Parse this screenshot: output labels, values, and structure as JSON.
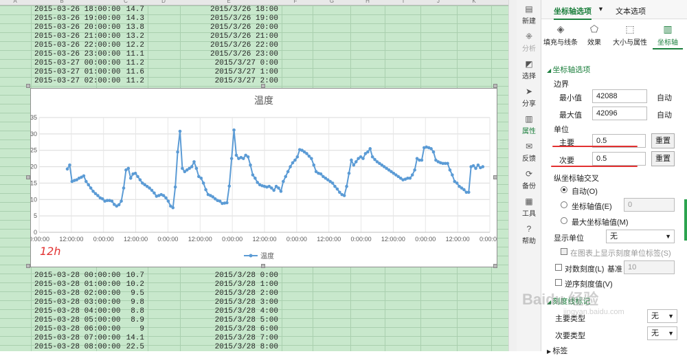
{
  "sheet": {
    "col_headers": [
      "A",
      "B",
      "C",
      "D",
      "E",
      "F",
      "G",
      "H",
      "I",
      "J",
      "K"
    ],
    "rows_top": [
      {
        "b": "2015-03-26 18:00:00",
        "c": "14.7",
        "e": "2015/3/26 18:00"
      },
      {
        "b": "2015-03-26 19:00:00",
        "c": "14.3",
        "e": "2015/3/26 19:00"
      },
      {
        "b": "2015-03-26 20:00:00",
        "c": "13.8",
        "e": "2015/3/26 20:00"
      },
      {
        "b": "2015-03-26 21:00:00",
        "c": "13.2",
        "e": "2015/3/26 21:00"
      },
      {
        "b": "2015-03-26 22:00:00",
        "c": "12.2",
        "e": "2015/3/26 22:00"
      },
      {
        "b": "2015-03-26 23:00:00",
        "c": "11.1",
        "e": "2015/3/26 23:00"
      },
      {
        "b": "2015-03-27 00:00:00",
        "c": "11.2",
        "e": "2015/3/27 0:00"
      },
      {
        "b": "2015-03-27 01:00:00",
        "c": "11.6",
        "e": "2015/3/27 1:00"
      },
      {
        "b": "2015-03-27 02:00:00",
        "c": "11.2",
        "e": "2015/3/27 2:00"
      }
    ],
    "rows_bottom": [
      {
        "b": "2015-03-28 00:00:00",
        "c": "10.7",
        "e": "2015/3/28 0:00"
      },
      {
        "b": "2015-03-28 01:00:00",
        "c": "10.2",
        "e": "2015/3/28 1:00"
      },
      {
        "b": "2015-03-28 02:00:00",
        "c": "9.5",
        "e": "2015/3/28 2:00"
      },
      {
        "b": "2015-03-28 03:00:00",
        "c": "9.8",
        "e": "2015/3/28 3:00"
      },
      {
        "b": "2015-03-28 04:00:00",
        "c": "8.8",
        "e": "2015/3/28 4:00"
      },
      {
        "b": "2015-03-28 05:00:00",
        "c": "8.9",
        "e": "2015/3/28 5:00"
      },
      {
        "b": "2015-03-28 06:00:00",
        "c": "9",
        "e": "2015/3/28 6:00"
      },
      {
        "b": "2015-03-28 07:00:00",
        "c": "14.1",
        "e": "2015/3/28 7:00"
      },
      {
        "b": "2015-03-28 08:00:00",
        "c": "22.5",
        "e": "2015/3/28 8:00"
      }
    ]
  },
  "annotation": "12h",
  "chart_data": {
    "type": "line",
    "title": "温度",
    "xlabel": "",
    "ylabel": "",
    "ylim": [
      0,
      35
    ],
    "y_ticks": [
      0,
      5,
      10,
      15,
      20,
      25,
      30,
      35
    ],
    "x_tick_labels": [
      "0:00:00",
      "12:00:00",
      "0:00:00",
      "12:00:00",
      "0:00:00",
      "12:00:00",
      "0:00:00",
      "12:00:00",
      "0:00:00",
      "12:00:00",
      "0:00:00",
      "12:00:00",
      "0:00:00",
      "12:00:00",
      "0:00:00"
    ],
    "xlim": [
      42088,
      42096
    ],
    "grid": true,
    "legend": "bottom",
    "series_color": "#5b9bd5",
    "series": [
      {
        "name": "温度",
        "x_start": 42088.5,
        "x_step_hours": 1,
        "values": [
          19.3,
          20.5,
          15.5,
          15.8,
          16.0,
          16.5,
          16.8,
          17.2,
          15.5,
          14.5,
          13.5,
          12.5,
          11.8,
          11.2,
          10.5,
          10.2,
          9.5,
          9.7,
          9.7,
          9.5,
          8.5,
          8.0,
          8.4,
          9.5,
          13.5,
          19.0,
          19.5,
          16.5,
          17.8,
          18.0,
          17.0,
          16.0,
          15.0,
          14.5,
          14.0,
          13.5,
          12.8,
          12.0,
          11.0,
          11.2,
          11.5,
          11.2,
          10.5,
          9.5,
          8.0,
          7.5,
          13.8,
          24.5,
          30.8,
          19.5,
          18.5,
          19.0,
          19.5,
          20.0,
          21.5,
          19.5,
          17.0,
          16.5,
          15.0,
          13.0,
          11.5,
          11.2,
          10.8,
          10.2,
          9.7,
          9.5,
          8.8,
          8.9,
          9.0,
          14.1,
          22.5,
          31.2,
          23.5,
          22.5,
          22.8,
          22.5,
          23.5,
          23.0,
          20.5,
          17.5,
          16.5,
          15.2,
          14.5,
          14.2,
          14.0,
          13.8,
          14.0,
          13.5,
          12.8,
          14.0,
          13.5,
          12.5,
          15.5,
          17.0,
          18.5,
          20.0,
          21.2,
          22.0,
          23.0,
          25.2,
          25.0,
          24.5,
          24.0,
          23.2,
          22.5,
          20.5,
          18.5,
          18.0,
          17.8,
          17.0,
          16.5,
          16.0,
          15.5,
          15.0,
          14.0,
          13.2,
          12.2,
          11.5,
          11.2,
          14.0,
          18.0,
          22.0,
          20.5,
          21.5,
          22.5,
          23.0,
          22.5,
          24.0,
          24.5,
          25.5,
          23.0,
          22.2,
          21.5,
          21.0,
          20.5,
          20.0,
          19.5,
          19.0,
          18.5,
          18.0,
          17.5,
          17.0,
          16.5,
          16.0,
          16.2,
          16.5,
          16.5,
          17.5,
          19.0,
          22.5,
          22.0,
          22.0,
          25.8,
          26.0,
          25.8,
          25.5,
          24.5,
          22.0,
          21.5,
          21.2,
          21.0,
          21.0,
          21.0,
          19.0,
          17.5,
          15.5,
          15.0,
          14.0,
          13.5,
          13.0,
          12.2,
          12.2,
          20.0,
          20.3,
          19.5,
          20.5,
          19.7,
          20.0
        ]
      }
    ]
  },
  "toolbar": {
    "items": [
      {
        "label": "新建",
        "icon": "new-doc-icon",
        "glyph": "▤"
      },
      {
        "label": "分析",
        "icon": "analyze-icon",
        "glyph": "⁜"
      },
      {
        "label": "选择",
        "icon": "select-icon",
        "glyph": "◩"
      },
      {
        "label": "分享",
        "icon": "share-icon",
        "glyph": "➤"
      },
      {
        "label": "属性",
        "icon": "properties-icon",
        "glyph": "▥"
      },
      {
        "label": "反馈",
        "icon": "feedback-icon",
        "glyph": "✉"
      },
      {
        "label": "备份",
        "icon": "backup-icon",
        "glyph": "⟳"
      },
      {
        "label": "工具",
        "icon": "toolbox-icon",
        "glyph": "▦"
      },
      {
        "label": "帮助",
        "icon": "help-icon",
        "glyph": "?"
      }
    ]
  },
  "panel": {
    "tab_axis_options": "坐标轴选项",
    "tab_text_options": "文本选项",
    "subtabs": [
      "填充与线条",
      "效果",
      "大小与属性",
      "坐标轴"
    ],
    "section_axis_options": "坐标轴选项",
    "bounds_label": "边界",
    "min_label": "最小值",
    "min_value": "42088",
    "min_auto": "自动",
    "max_label": "最大值",
    "max_value": "42096",
    "max_auto": "自动",
    "units_label": "单位",
    "major_label": "主要",
    "major_value": "0.5",
    "minor_label": "次要",
    "minor_value": "0.5",
    "reset_label": "重置",
    "cross_label": "纵坐标轴交叉",
    "cross_auto": "自动(O)",
    "cross_value_label": "坐标轴值(E)",
    "cross_value": "0",
    "cross_max": "最大坐标轴值(M)",
    "display_units_label": "显示单位",
    "display_units_value": "无",
    "show_units_label": "在图表上显示刻度单位标签(S)",
    "log_scale_label": "对数刻度(L)",
    "base_label": "基准",
    "base_value": "10",
    "reverse_label": "逆序刻度值(V)",
    "tick_marks_label": "刻度线标记",
    "major_type_label": "主要类型",
    "major_type_value": "无",
    "minor_type_label": "次要类型",
    "minor_type_value": "无",
    "labels_label": "标签"
  },
  "watermark": {
    "text": "Baidu 经验",
    "url": "jingyan.baidu.com"
  }
}
